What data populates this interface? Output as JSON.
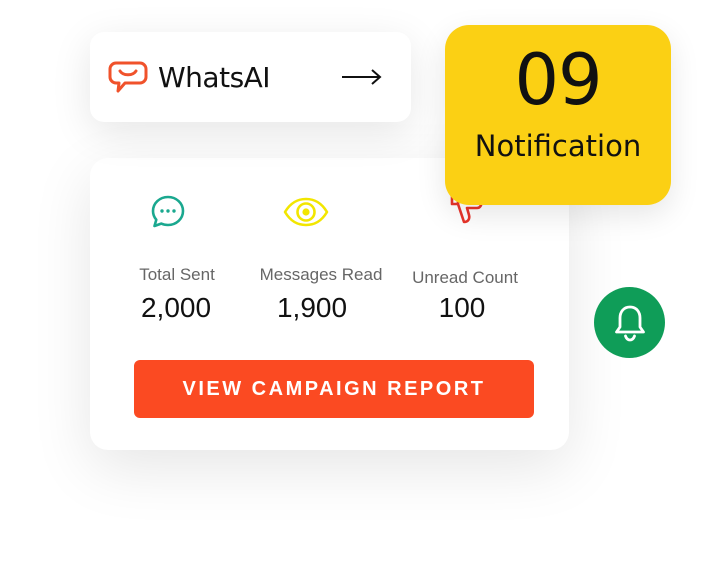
{
  "brand": {
    "name": "WhatsAI",
    "logo_icon": "chat-smile-icon",
    "logo_color": "#f0522b",
    "arrow_icon": "arrow-right-icon"
  },
  "notification": {
    "count": "09",
    "label": "Notification",
    "background": "#fbd014"
  },
  "stats": {
    "items": [
      {
        "label": "Total Sent",
        "value": "2,000",
        "icon": "chat-bubble-icon",
        "color": "#1aa88f"
      },
      {
        "label": "Messages Read",
        "value": "1,900",
        "icon": "eye-icon",
        "color": "#f2e600"
      },
      {
        "label": "Unread Count",
        "value": "100",
        "icon": "thumbs-down-icon",
        "color": "#e8342a"
      }
    ],
    "button_label": "VIEW CAMPAIGN REPORT",
    "button_color": "#fb4a22"
  },
  "bell": {
    "icon": "bell-icon",
    "color": "#0f9d58"
  }
}
